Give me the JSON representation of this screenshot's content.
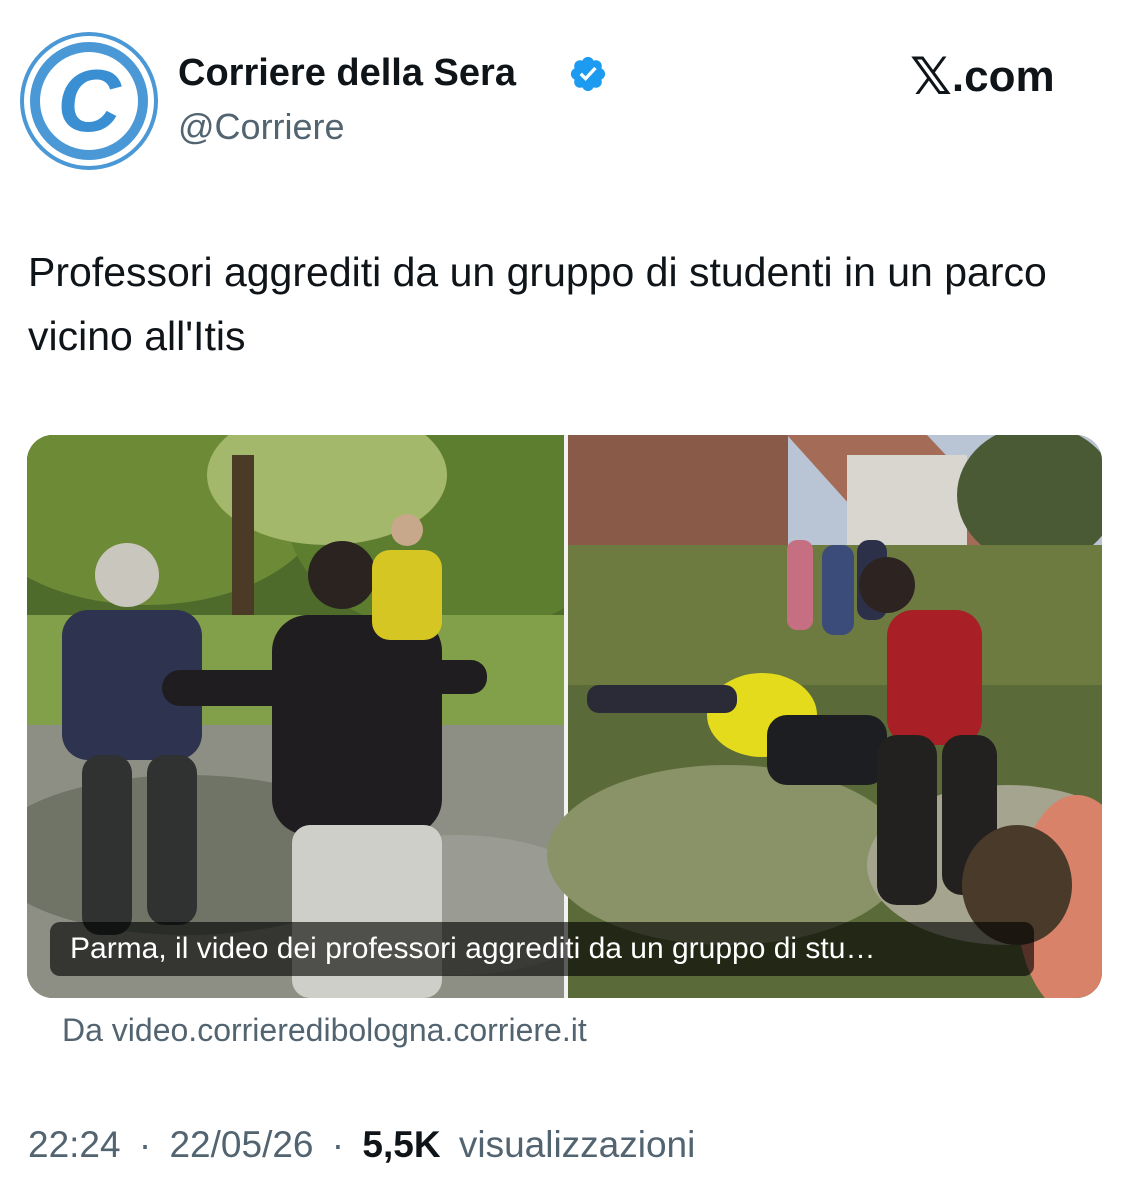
{
  "author": {
    "name": "Corriere della Sera",
    "handle": "@Corriere",
    "avatar_letter": "C",
    "verified": true
  },
  "site": {
    "logo_mark": "𝕏",
    "logo_suffix": ".com"
  },
  "tweet": {
    "text": "Professori aggrediti da un gruppo di studenti in un parco vicino all'Itis"
  },
  "media": {
    "caption": "Parma, il video dei professori aggrediti da un gruppo di stu…",
    "source": "Da video.corrieredibologna.corriere.it"
  },
  "meta": {
    "time": "22:24",
    "separator": "·",
    "date": "22/05/26",
    "views_count": "5,5K",
    "views_label": "visualizzazioni"
  },
  "colors": {
    "text_primary": "#0f1419",
    "text_secondary": "#536471",
    "verified_blue": "#1d9bf0",
    "avatar_blue": "#4a98d6"
  }
}
